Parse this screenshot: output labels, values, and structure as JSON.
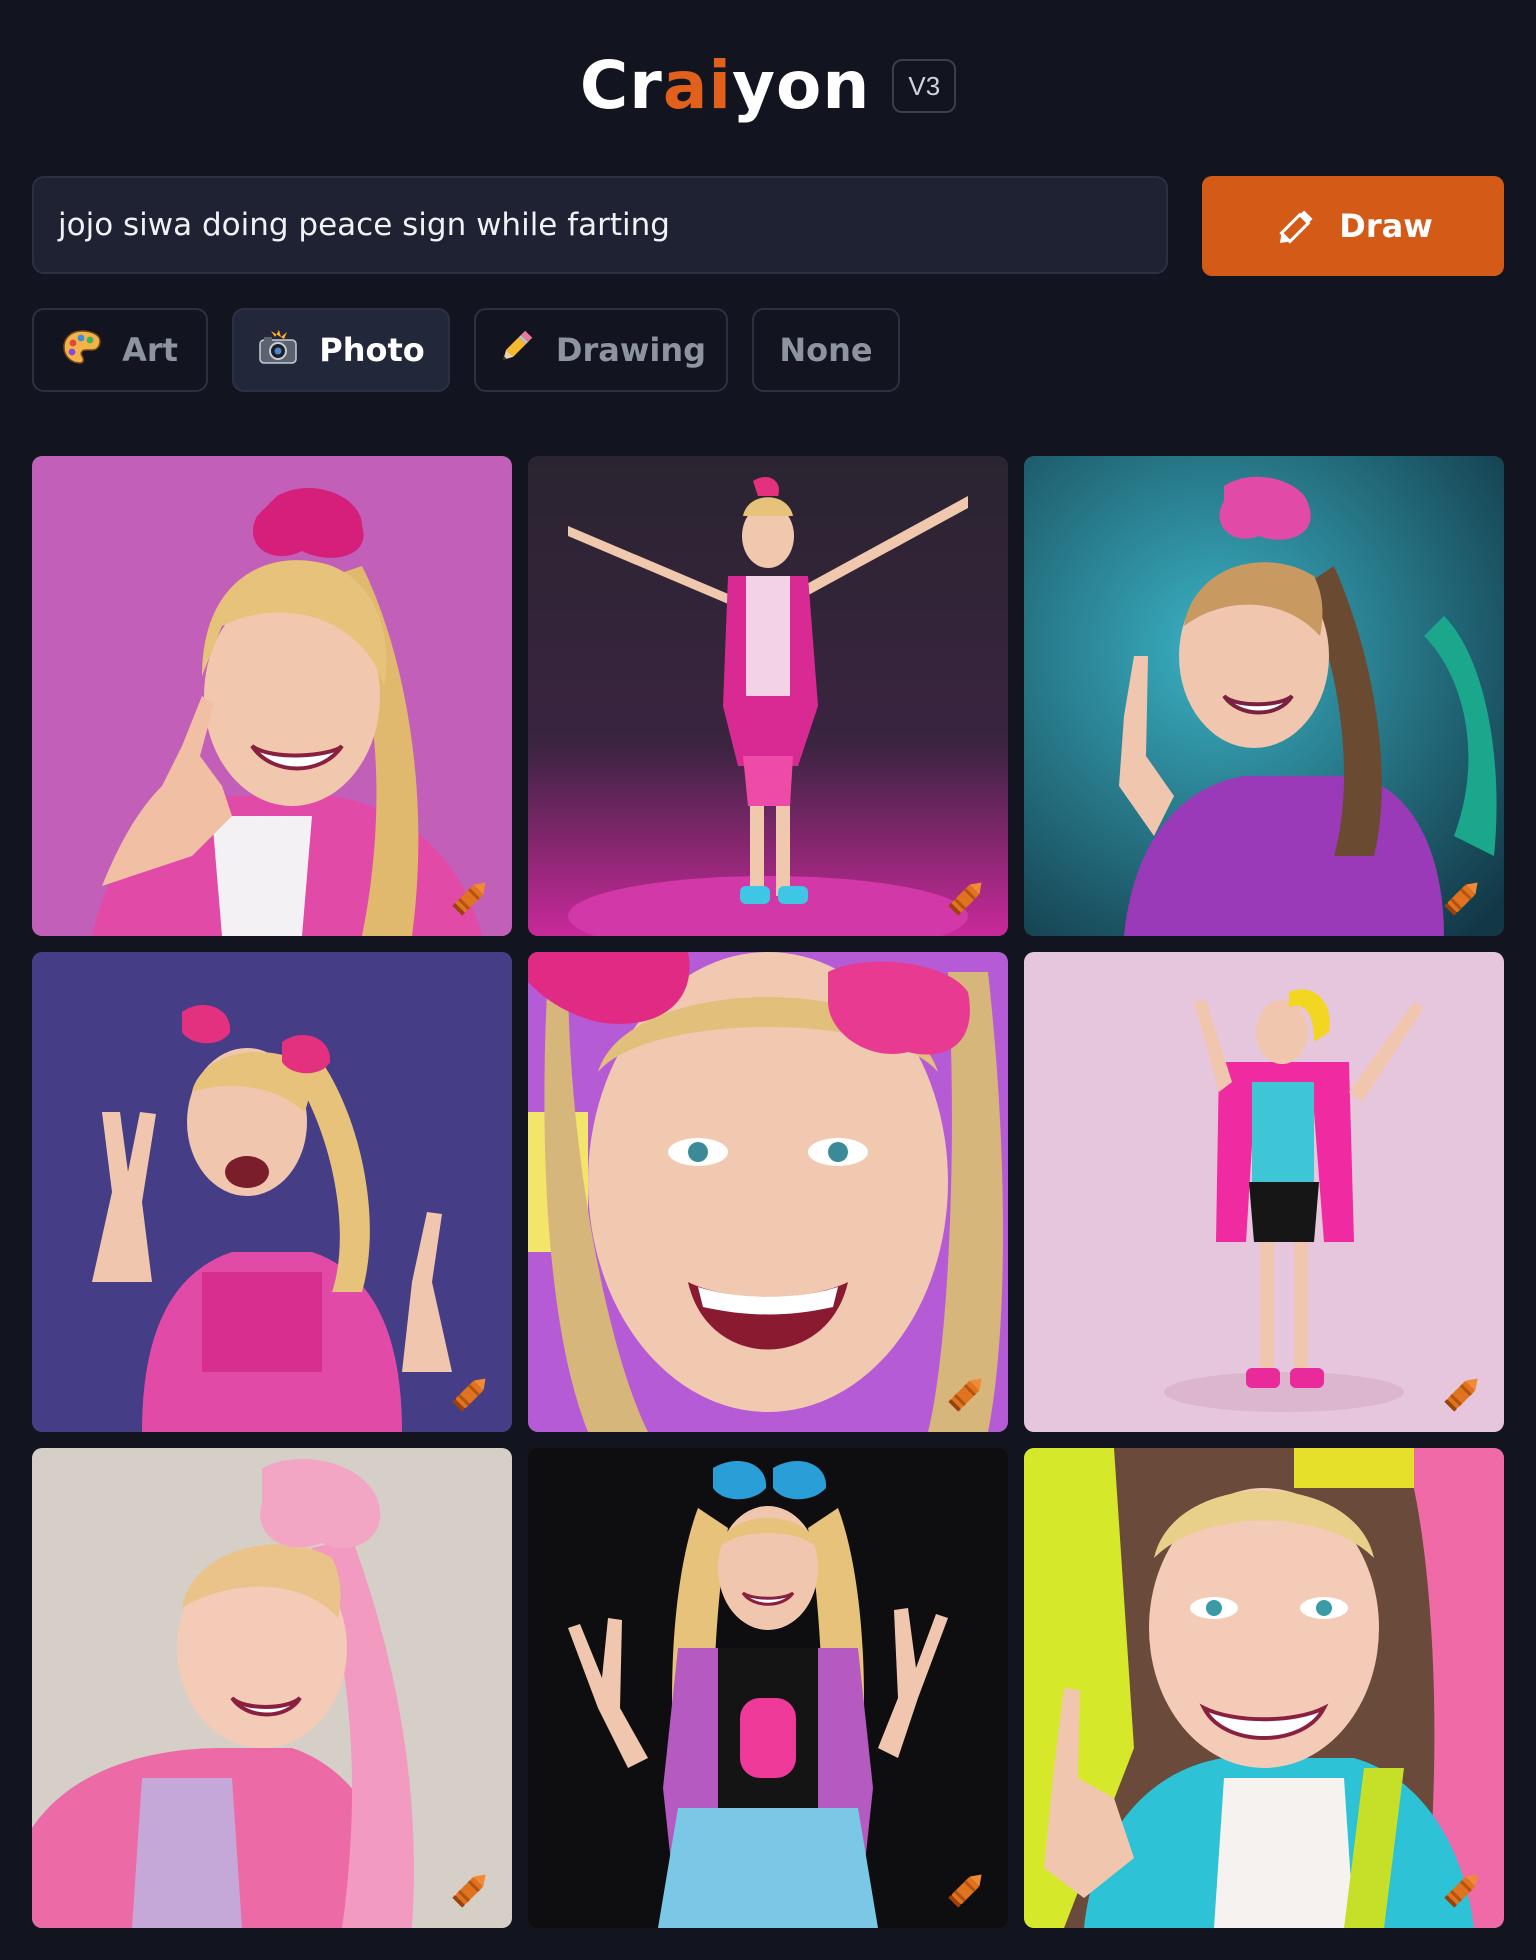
{
  "header": {
    "logo_part1": "Cr",
    "logo_accent": "ai",
    "logo_part2": "yon",
    "version": "V3",
    "accent_color": "#e0601c"
  },
  "prompt": {
    "value": "jojo siwa doing peace sign while farting"
  },
  "draw_button": {
    "label": "Draw",
    "icon": "pencil-icon",
    "color": "#d35a17"
  },
  "styles": [
    {
      "label": "Art",
      "icon": "palette-icon",
      "selected": false
    },
    {
      "label": "Photo",
      "icon": "camera-flash-icon",
      "selected": true
    },
    {
      "label": "Drawing",
      "icon": "pencil-icon",
      "selected": false
    },
    {
      "label": "None",
      "icon": "",
      "selected": false
    }
  ],
  "results": {
    "count": 9,
    "badge_icon": "crayon-icon"
  }
}
